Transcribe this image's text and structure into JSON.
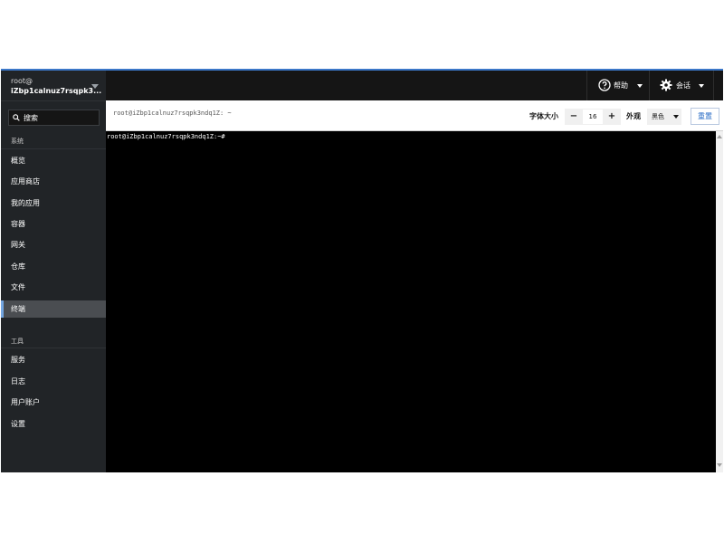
{
  "host": {
    "user": "root@",
    "name": "iZbp1calnuz7rsqpk3..."
  },
  "search": {
    "placeholder": "搜索"
  },
  "sidebar": {
    "section_system": "系统",
    "system_items": [
      "概览",
      "应用商店",
      "我的应用",
      "容器",
      "网关",
      "仓库",
      "文件",
      "终端"
    ],
    "active_item": "终端",
    "section_tools": "工具",
    "tool_items": [
      "服务",
      "日志",
      "用户账户",
      "设置"
    ]
  },
  "topbar": {
    "help_label": "帮助",
    "session_label": "会话"
  },
  "toolbar": {
    "title": "root@iZbp1calnuz7rsqpk3ndq1Z: ~",
    "font_size_label": "字体大小",
    "font_size_minus": "−",
    "font_size_value": "16",
    "font_size_plus": "+",
    "appearance_label": "外观",
    "appearance_value": "黑色",
    "reset_label": "重置"
  },
  "terminal": {
    "prompt": "root@iZbp1calnuz7rsqpk3ndq1Z:~#"
  },
  "colors": {
    "accent": "#3b77c8",
    "sidebar_bg": "#212427",
    "terminal_bg": "#000000",
    "active_bar": "#73a5e0"
  }
}
